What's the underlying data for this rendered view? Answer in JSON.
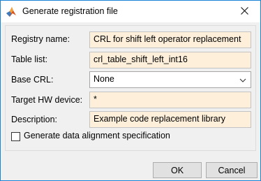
{
  "window": {
    "title": "Generate registration file"
  },
  "form": {
    "registry_name_label": "Registry name:",
    "registry_name_value": "CRL for shift left operator replacement",
    "table_list_label": "Table list:",
    "table_list_value": "crl_table_shift_left_int16",
    "base_crl_label": "Base CRL:",
    "base_crl_value": "None",
    "target_hw_label": "Target HW device:",
    "target_hw_value": "*",
    "description_label": "Description:",
    "description_value": "Example code replacement library",
    "data_alignment_label": "Generate data alignment specification"
  },
  "buttons": {
    "ok": "OK",
    "cancel": "Cancel"
  },
  "colors": {
    "field_bg": "#fdefd9",
    "window_border": "#1883d7",
    "dialog_bg": "#f0f0f0"
  },
  "icons": {
    "app": "matlab-logo-icon",
    "close": "close-icon",
    "dropdown": "chevron-down-icon"
  }
}
